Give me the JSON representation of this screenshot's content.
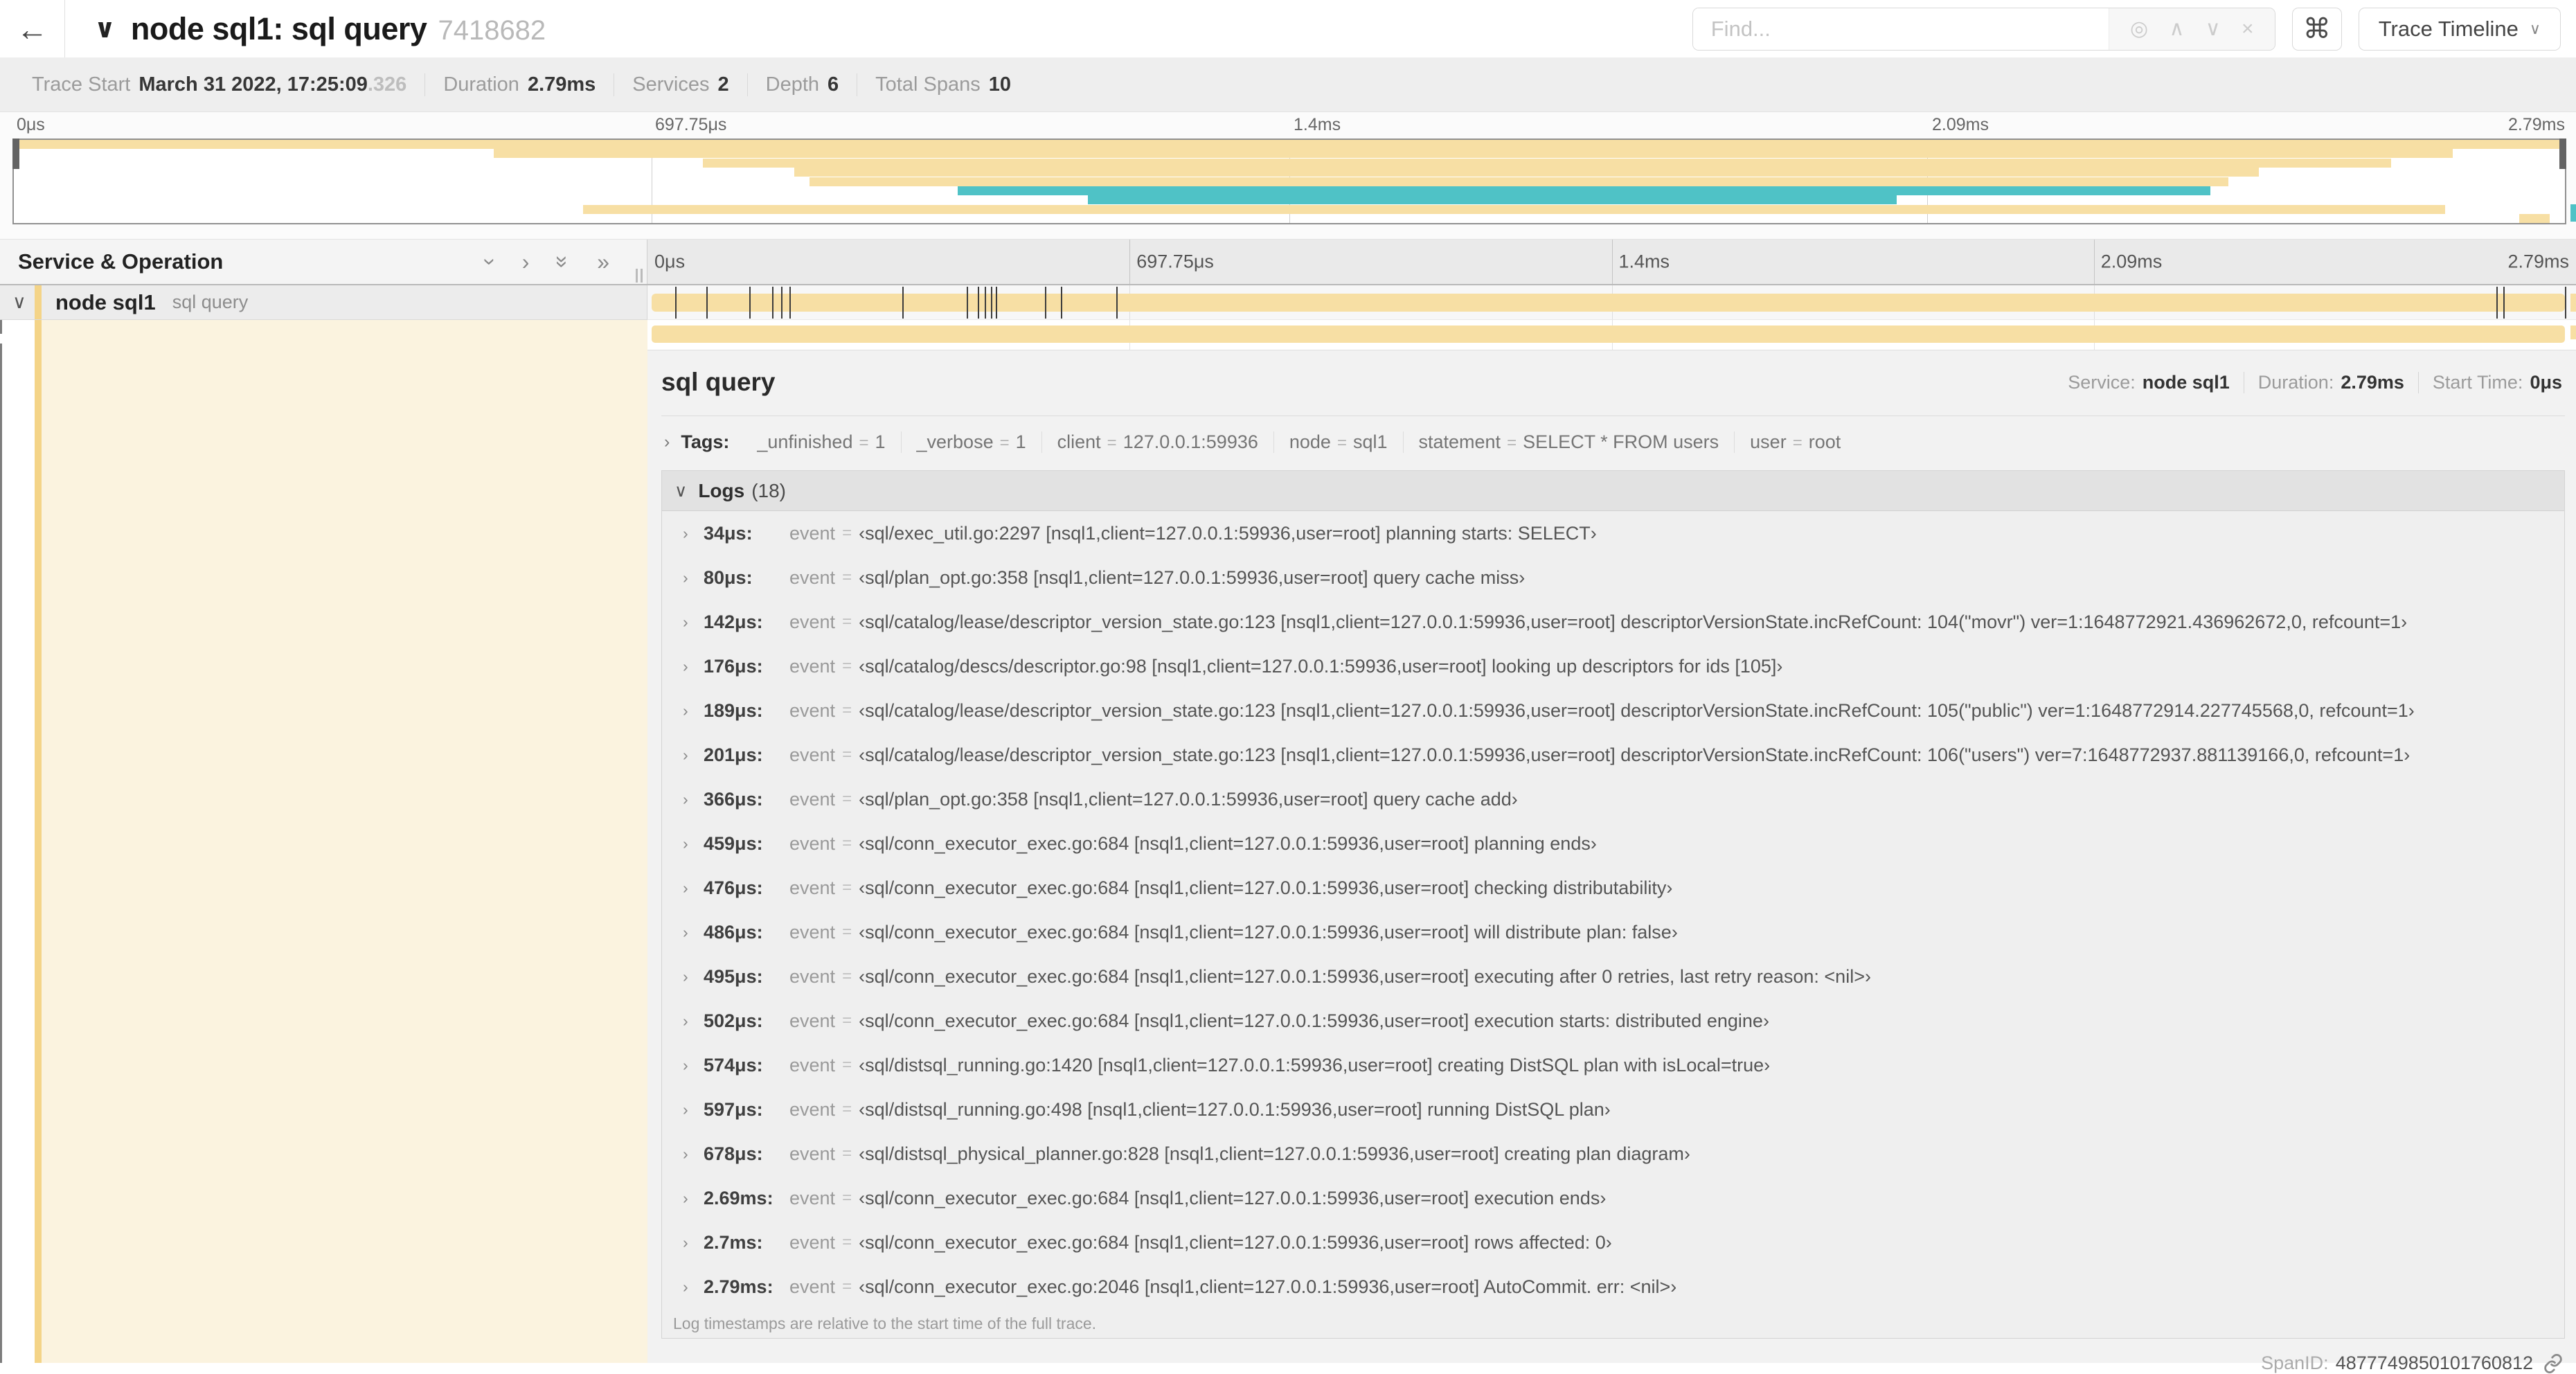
{
  "header": {
    "back_icon": "←",
    "collapse_icon": "∨",
    "title": "node sql1: sql query",
    "trace_id": "7418682",
    "find_placeholder": "Find...",
    "find_icons": [
      {
        "name": "locate-icon",
        "glyph": "◎"
      },
      {
        "name": "prev-result-icon",
        "glyph": "∧"
      },
      {
        "name": "next-result-icon",
        "glyph": "∨"
      },
      {
        "name": "clear-search-icon",
        "glyph": "×"
      }
    ],
    "shortcut_icon": "⌘",
    "view_selector": "Trace Timeline",
    "view_selector_chevron": "∨"
  },
  "summary": {
    "items": [
      {
        "label": "Trace Start",
        "value": "March 31 2022, 17:25:09",
        "suffix": ".326"
      },
      {
        "label": "Duration",
        "value": "2.79ms"
      },
      {
        "label": "Services",
        "value": "2"
      },
      {
        "label": "Depth",
        "value": "6"
      },
      {
        "label": "Total Spans",
        "value": "10"
      }
    ]
  },
  "colors": {
    "span_tan": "#f7dfa4",
    "span_teal": "#4fc2c6",
    "row_stripe": "#f4d488",
    "expanded_bg": "#fbf3df"
  },
  "minimap": {
    "tick_labels": [
      "0μs",
      "697.75μs",
      "1.4ms",
      "2.09ms",
      "2.79ms"
    ],
    "spans": [
      {
        "start": 0,
        "end": 100,
        "color": "span_tan"
      },
      {
        "start": 18.8,
        "end": 95.6,
        "color": "span_tan"
      },
      {
        "start": 27.0,
        "end": 93.2,
        "color": "span_tan"
      },
      {
        "start": 30.6,
        "end": 88.0,
        "color": "span_tan"
      },
      {
        "start": 31.2,
        "end": 86.8,
        "color": "span_tan"
      },
      {
        "start": 37.0,
        "end": 86.1,
        "color": "span_teal"
      },
      {
        "start": 42.1,
        "end": 73.8,
        "color": "span_teal"
      },
      {
        "start": 22.3,
        "end": 95.3,
        "color": "span_tan"
      },
      {
        "start": 98.2,
        "end": 99.4,
        "color": "span_tan"
      }
    ]
  },
  "timeline_header": {
    "label": "Service & Operation",
    "collapse_icons": [
      {
        "name": "collapse-one-icon",
        "glyph": "›",
        "rotate": true
      },
      {
        "name": "expand-one-icon",
        "glyph": "›",
        "rotate": false
      },
      {
        "name": "collapse-all-icon",
        "glyph": "»",
        "rotate": true
      },
      {
        "name": "expand-all-icon",
        "glyph": "»",
        "rotate": false
      }
    ],
    "ruler_labels": [
      "0μs",
      "697.75μs",
      "1.4ms",
      "2.09ms",
      "2.79ms"
    ]
  },
  "row": {
    "collapse_icon": "∨",
    "service": "node sql1",
    "operation": "sql query"
  },
  "timeline": {
    "duration_us": 2790
  },
  "detail": {
    "title": "sql query",
    "overview": [
      {
        "label": "Service:",
        "value": "node sql1"
      },
      {
        "label": "Duration:",
        "value": "2.79ms"
      },
      {
        "label": "Start Time:",
        "value": "0μs"
      }
    ],
    "expand_chevron": "›",
    "collapse_chevron": "∨",
    "eq_sign": "=",
    "tags_label": "Tags:",
    "tags": [
      {
        "key": "_unfinished",
        "value": "1"
      },
      {
        "key": "_verbose",
        "value": "1"
      },
      {
        "key": "client",
        "value": "127.0.0.1:59936"
      },
      {
        "key": "node",
        "value": "sql1"
      },
      {
        "key": "statement",
        "value": "SELECT * FROM users"
      },
      {
        "key": "user",
        "value": "root"
      }
    ],
    "logs_label": "Logs",
    "logs_count": "(18)",
    "log_key": "event",
    "logs": [
      {
        "time": "34μs:",
        "t_us": 34,
        "value": "‹sql/exec_util.go:2297 [nsql1,client=127.0.0.1:59936,user=root] planning starts: SELECT›"
      },
      {
        "time": "80μs:",
        "t_us": 80,
        "value": "‹sql/plan_opt.go:358 [nsql1,client=127.0.0.1:59936,user=root] query cache miss›"
      },
      {
        "time": "142μs:",
        "t_us": 142,
        "value": "‹sql/catalog/lease/descriptor_version_state.go:123 [nsql1,client=127.0.0.1:59936,user=root] descriptorVersionState.incRefCount: 104(\"movr\") ver=1:1648772921.436962672,0, refcount=1›"
      },
      {
        "time": "176μs:",
        "t_us": 176,
        "value": "‹sql/catalog/descs/descriptor.go:98 [nsql1,client=127.0.0.1:59936,user=root] looking up descriptors for ids [105]›"
      },
      {
        "time": "189μs:",
        "t_us": 189,
        "value": "‹sql/catalog/lease/descriptor_version_state.go:123 [nsql1,client=127.0.0.1:59936,user=root] descriptorVersionState.incRefCount: 105(\"public\") ver=1:1648772914.227745568,0, refcount=1›"
      },
      {
        "time": "201μs:",
        "t_us": 201,
        "value": "‹sql/catalog/lease/descriptor_version_state.go:123 [nsql1,client=127.0.0.1:59936,user=root] descriptorVersionState.incRefCount: 106(\"users\") ver=7:1648772937.881139166,0, refcount=1›"
      },
      {
        "time": "366μs:",
        "t_us": 366,
        "value": "‹sql/plan_opt.go:358 [nsql1,client=127.0.0.1:59936,user=root] query cache add›"
      },
      {
        "time": "459μs:",
        "t_us": 459,
        "value": "‹sql/conn_executor_exec.go:684 [nsql1,client=127.0.0.1:59936,user=root] planning ends›"
      },
      {
        "time": "476μs:",
        "t_us": 476,
        "value": "‹sql/conn_executor_exec.go:684 [nsql1,client=127.0.0.1:59936,user=root] checking distributability›"
      },
      {
        "time": "486μs:",
        "t_us": 486,
        "value": "‹sql/conn_executor_exec.go:684 [nsql1,client=127.0.0.1:59936,user=root] will distribute plan: false›"
      },
      {
        "time": "495μs:",
        "t_us": 495,
        "value": "‹sql/conn_executor_exec.go:684 [nsql1,client=127.0.0.1:59936,user=root] executing after 0 retries, last retry reason: <nil>›"
      },
      {
        "time": "502μs:",
        "t_us": 502,
        "value": "‹sql/conn_executor_exec.go:684 [nsql1,client=127.0.0.1:59936,user=root] execution starts: distributed engine›"
      },
      {
        "time": "574μs:",
        "t_us": 574,
        "value": "‹sql/distsql_running.go:1420 [nsql1,client=127.0.0.1:59936,user=root] creating DistSQL plan with isLocal=true›"
      },
      {
        "time": "597μs:",
        "t_us": 597,
        "value": "‹sql/distsql_running.go:498 [nsql1,client=127.0.0.1:59936,user=root] running DistSQL plan›"
      },
      {
        "time": "678μs:",
        "t_us": 678,
        "value": "‹sql/distsql_physical_planner.go:828 [nsql1,client=127.0.0.1:59936,user=root] creating plan diagram›"
      },
      {
        "time": "2.69ms:",
        "t_us": 2690,
        "value": "‹sql/conn_executor_exec.go:684 [nsql1,client=127.0.0.1:59936,user=root] execution ends›"
      },
      {
        "time": "2.7ms:",
        "t_us": 2700,
        "value": "‹sql/conn_executor_exec.go:684 [nsql1,client=127.0.0.1:59936,user=root] rows affected: 0›"
      },
      {
        "time": "2.79ms:",
        "t_us": 2790,
        "value": "‹sql/conn_executor_exec.go:2046 [nsql1,client=127.0.0.1:59936,user=root] AutoCommit. err: <nil>›"
      }
    ],
    "logs_note": "Log timestamps are relative to the start time of the full trace.",
    "span_id_label": "SpanID:",
    "span_id": "4877749850101760812"
  }
}
